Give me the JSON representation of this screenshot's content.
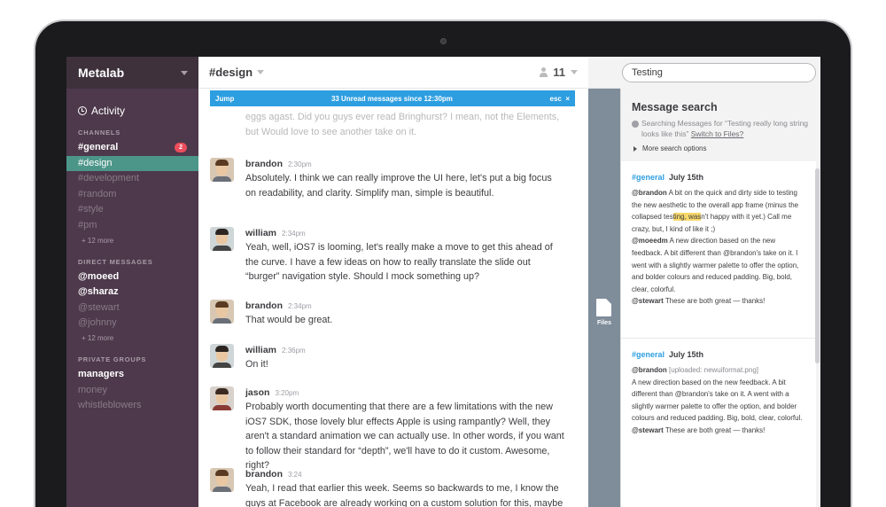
{
  "sidebar": {
    "team": "Metalab",
    "activity": "Activity",
    "channels_header": "CHANNELS",
    "channels": [
      {
        "name": "#general",
        "badge": "2"
      },
      {
        "name": "#design"
      },
      {
        "name": "#development"
      },
      {
        "name": "#random"
      },
      {
        "name": "#style"
      },
      {
        "name": "#pm"
      }
    ],
    "channels_more": "+ 12 more",
    "dm_header": "DIRECT MESSAGES",
    "dms": [
      "@moeed",
      "@sharaz",
      "@stewart",
      "@johnny"
    ],
    "dms_more": "+ 12 more",
    "groups_header": "PRIVATE GROUPS",
    "groups": [
      "managers",
      "money",
      "whistleblowers"
    ]
  },
  "channel": {
    "title": "#design",
    "member_count": "11",
    "unread_jump": "Jump",
    "unread_text": "33 Unread messages since 12:30pm",
    "unread_esc": "esc",
    "unread_close": "×"
  },
  "messages": [
    {
      "author": "",
      "time": "",
      "text": "eggs agast. Did you guys ever read Bringhurst? I mean, not the Elements, but Would love to see another take on it."
    },
    {
      "author": "brandon",
      "time": "2:30pm",
      "text": "Absolutely. I think we can really improve the UI here, let's put a big focus on readability, and clarity. Simplify man, simple is beautiful."
    },
    {
      "author": "william",
      "time": "2:34pm",
      "text": "Yeah, well, iOS7 is looming, let's really make a move to get this ahead of the curve. I have a few ideas on how to really translate the slide out “burger” navigation style. Should I mock something up?"
    },
    {
      "author": "brandon",
      "time": "2:34pm",
      "text": "That would be great."
    },
    {
      "author": "william",
      "time": "2:36pm",
      "text": "On it!"
    },
    {
      "author": "jason",
      "time": "3:20pm",
      "text": "Probably worth documenting that there are a few limitations with the new iOS7 SDK, those lovely blur effects Apple is using rampantly? Well, they aren't a standard animation we can actually use. In other words, if you want to follow their standard for “depth”, we'll have to do it custom. Awesome, right?"
    },
    {
      "author": "brandon",
      "time": "3:24",
      "text": "Yeah, I read that earlier this week. Seems so backwards to me, I know the guys at Facebook are already working on a custom solution for this, maybe"
    }
  ],
  "files": {
    "label": "Files"
  },
  "search": {
    "query": "Testing",
    "title": "Message search",
    "searching_prefix": "Searching Messages for “Testing really long string looks like this”",
    "switch_link": "Switch to Files?",
    "more_options": "More search options",
    "results": [
      {
        "channel": "#general",
        "date": "July 15th",
        "a1": "@brandon",
        "t1a": "A bit on the quick and dirty side to testing the new aesthetic to the overall app frame (minus the collapsed tes",
        "t1hl": "ting, was",
        "t1b": "n't happy with it yet.) Call me crazy, but, I kind of like it ;)",
        "a2": "@moeedm",
        "t2": "A new direction based on the new feedback. A bit different than @brandon's take on it. I went with a slightly warmer palette to offer the option, and bolder colours and reduced padding. Big, bold, clear, colorful.",
        "a3": "@stewart",
        "t3": "These are both great — thanks!"
      },
      {
        "channel": "#general",
        "date": "July 15th",
        "a1": "@brandon",
        "t1": "[uploaded: newuiformat.png]",
        "t1b": "A new direction based on the new feedback. A bit different than @brandon's take on it. A went with a slightly warmer palette to offer the option, and bolder colours and reduced padding. Big, bold, clear, colorful.",
        "a2": "@stewart",
        "t2": "These are both great — thanks!"
      }
    ]
  }
}
